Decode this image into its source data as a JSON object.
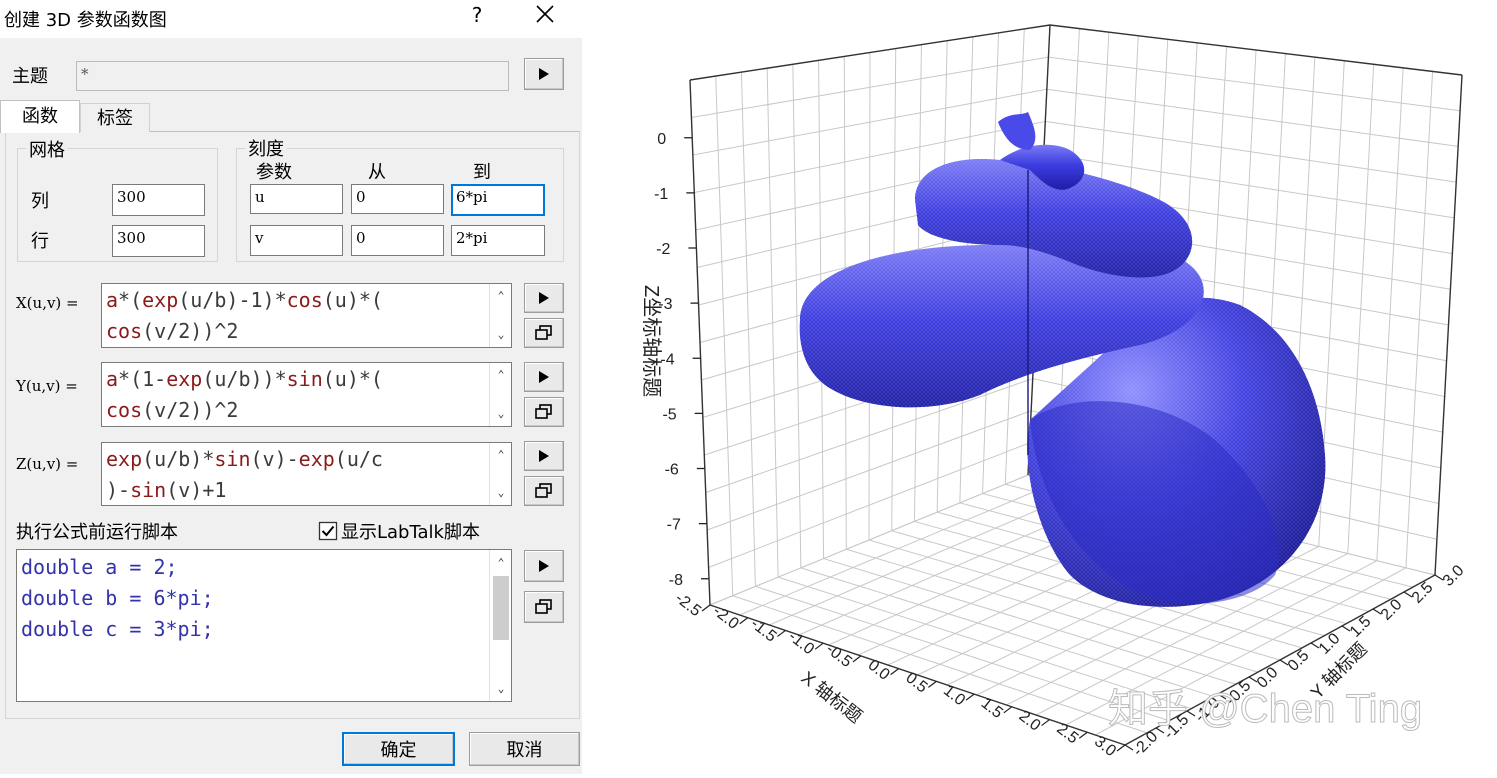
{
  "dialog": {
    "title": "创建 3D 参数函数图",
    "help": "?",
    "subject": {
      "label": "主题",
      "value": "*"
    },
    "tabs": [
      {
        "label": "函数"
      },
      {
        "label": "标签"
      }
    ],
    "grid": {
      "title": "网格",
      "cols_label": "列",
      "rows_label": "行",
      "cols_value": "300",
      "rows_value": "300"
    },
    "scale": {
      "title": "刻度",
      "headers": {
        "param": "参数",
        "from": "从",
        "to": "到"
      },
      "rows": [
        {
          "param": "u",
          "from": "0",
          "to": "6*pi"
        },
        {
          "param": "v",
          "from": "0",
          "to": "2*pi"
        }
      ]
    },
    "x_eq": {
      "label": "X(u,v) =",
      "line1": [
        [
          "a",
          "c-fn"
        ],
        [
          "*(",
          "c-op"
        ],
        [
          "exp",
          "c-fn"
        ],
        [
          "(u/b)-1)",
          "c-op"
        ],
        [
          "*",
          "c-op"
        ],
        [
          "cos",
          "c-fn"
        ],
        [
          "(u)*(",
          "c-op"
        ]
      ],
      "line2": [
        [
          "cos",
          "c-fn"
        ],
        [
          "(v/2))^2",
          "c-op"
        ]
      ]
    },
    "y_eq": {
      "label": "Y(u,v) =",
      "line1": [
        [
          "a",
          "c-fn"
        ],
        [
          "*(1-",
          "c-op"
        ],
        [
          "exp",
          "c-fn"
        ],
        [
          "(u/b))*",
          "c-op"
        ],
        [
          "sin",
          "c-fn"
        ],
        [
          "(u)*(",
          "c-op"
        ]
      ],
      "line2": [
        [
          "cos",
          "c-fn"
        ],
        [
          "(v/2))^2",
          "c-op"
        ]
      ]
    },
    "z_eq": {
      "label": "Z(u,v) =",
      "line1": [
        [
          "exp",
          "c-fn"
        ],
        [
          "(u/b)*",
          "c-op"
        ],
        [
          "sin",
          "c-fn"
        ],
        [
          "(v)-",
          "c-op"
        ],
        [
          "exp",
          "c-fn"
        ],
        [
          "(u/c",
          "c-op"
        ]
      ],
      "line2": [
        [
          ")-",
          "c-op"
        ],
        [
          "sin",
          "c-fn"
        ],
        [
          "(v)+1",
          "c-op"
        ]
      ]
    },
    "script": {
      "label": "执行公式前运行脚本",
      "show_labtalk": "显示LabTalk脚本",
      "show_labtalk_checked": true,
      "lines": [
        {
          "kw": "double",
          "rest": " a = 2;"
        },
        {
          "kw": "double",
          "rest": " b = 6*pi;"
        },
        {
          "kw": "double",
          "rest": " c = 3*pi;"
        }
      ]
    },
    "ok": "确定",
    "cancel": "取消"
  },
  "chart_data": {
    "type": "surface",
    "title": "",
    "xlabel": "X 轴标题",
    "ylabel": "Y 轴标题",
    "zlabel": "Z坐标轴标题",
    "xlim": [
      -2.5,
      3.0
    ],
    "ylim": [
      -2.0,
      3.0
    ],
    "zlim": [
      -8,
      0
    ],
    "x_ticks": [
      "-2.5",
      "-2.0",
      "-1.5",
      "-1.0",
      "-0.5",
      "0.0",
      "0.5",
      "1.0",
      "1.5",
      "2.0",
      "2.5",
      "3.0"
    ],
    "y_ticks": [
      "-2.0",
      "-1.5",
      "-1.0",
      "-0.5",
      "0.0",
      "0.5",
      "1.0",
      "1.5",
      "2.0",
      "2.5",
      "3.0"
    ],
    "z_ticks": [
      "0",
      "-1",
      "-2",
      "-3",
      "-4",
      "-5",
      "-6",
      "-7",
      "-8"
    ],
    "parameters": {
      "a": 2,
      "b": "6*pi",
      "c": "3*pi",
      "u_range": [
        "0",
        "6*pi"
      ],
      "v_range": [
        "0",
        "2*pi"
      ],
      "grid": [
        300,
        300
      ]
    },
    "surface_color": "#3a3ad8",
    "grid": true
  },
  "watermark": "知乎 @Chen Ting"
}
